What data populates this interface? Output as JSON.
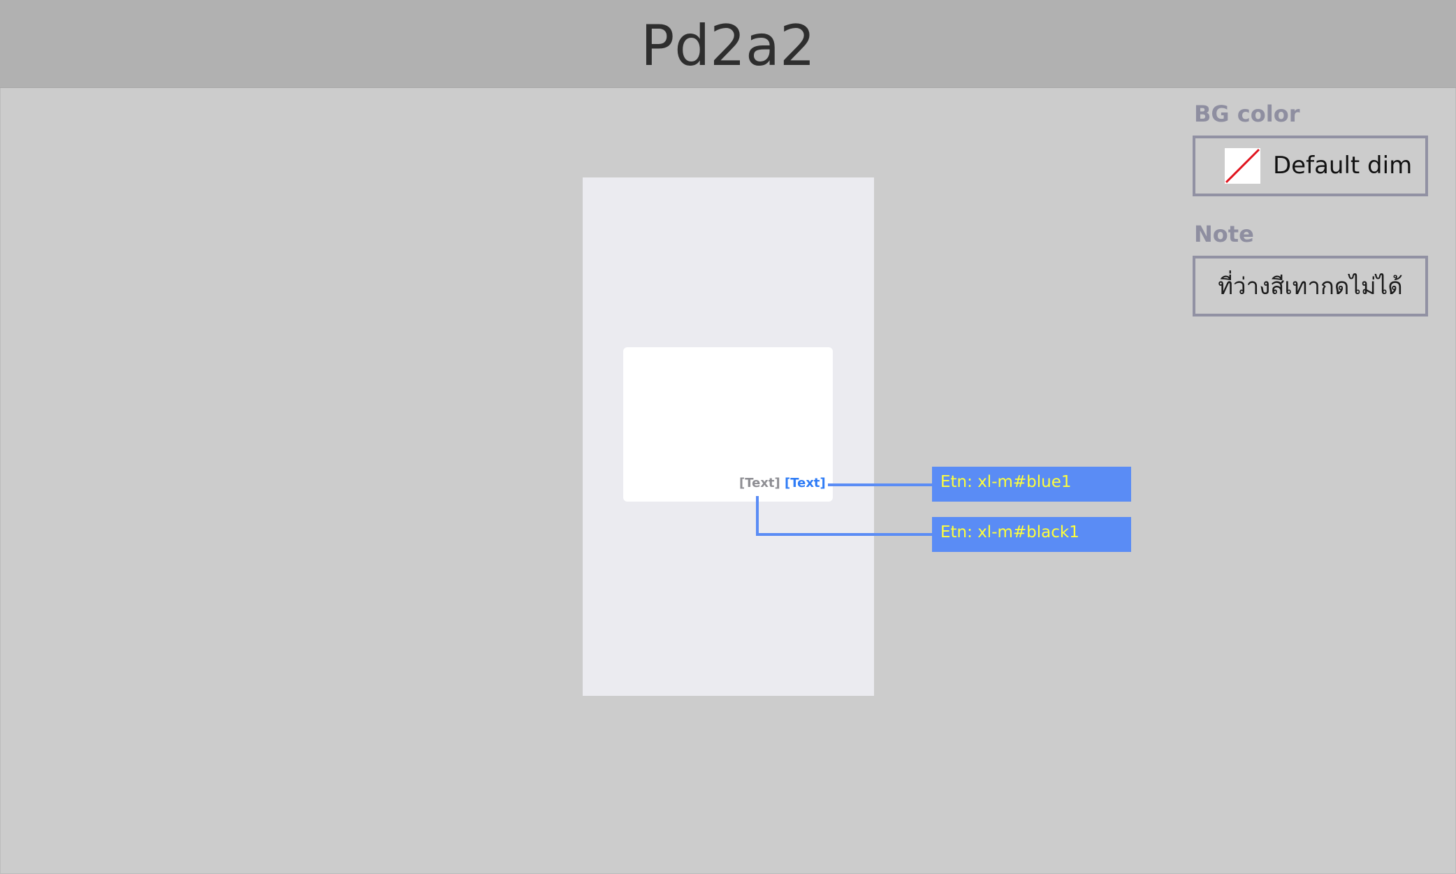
{
  "header": {
    "title": "Pd2a2"
  },
  "card": {
    "text_gray": "[Text]",
    "text_blue": "[Text]"
  },
  "annotations": [
    {
      "label": "Etn: xl-m#blue1"
    },
    {
      "label": "Etn: xl-m#black1"
    }
  ],
  "panel": {
    "bg_color": {
      "label": "BG color",
      "value": "Default dim"
    },
    "note": {
      "label": "Note",
      "value": "ที่ว่างสีเทากดไม่ได้"
    }
  },
  "colors": {
    "header_bg": "#b1b1b1",
    "canvas_bg": "#cccccc",
    "phone_bg": "#ebebf0",
    "accent_blue": "#5a8cf5",
    "tag_text": "#ffff3b",
    "label_gray": "#8e8ea0"
  },
  "icons": {
    "bg_swatch": "no-color-swatch-icon"
  }
}
